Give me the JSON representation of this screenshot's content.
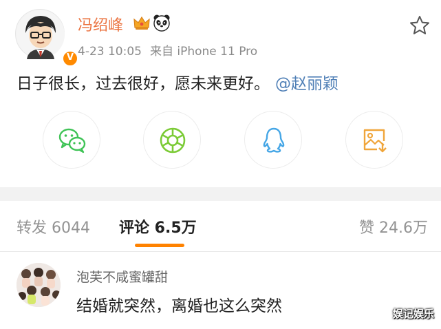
{
  "post": {
    "author": "冯绍峰",
    "badge_letter": "V",
    "date": "4-23 10:05",
    "source": "来自 iPhone 11 Pro",
    "text": "日子很长，过去很好，愿未来更好。",
    "mention": "@赵丽颖"
  },
  "share": {
    "items": [
      {
        "icon": "wechat-icon",
        "color": "#3fc356"
      },
      {
        "icon": "moments-icon",
        "color": "#7ccb37"
      },
      {
        "icon": "qq-icon",
        "color": "#45a6e6"
      },
      {
        "icon": "save-image-icon",
        "color": "#f0a53a"
      }
    ]
  },
  "tabs": {
    "repost": "转发 6044",
    "comments": "评论 6.5万",
    "likes": "赞 24.6万"
  },
  "comment": {
    "user": "泡芙不咸蜜罐甜",
    "text": "结婚就突然，离婚也这么突然"
  },
  "watermark": "娱记娱乐",
  "colors": {
    "accent": "#ff8200",
    "author": "#eb7340",
    "link": "#4f7fb6"
  }
}
